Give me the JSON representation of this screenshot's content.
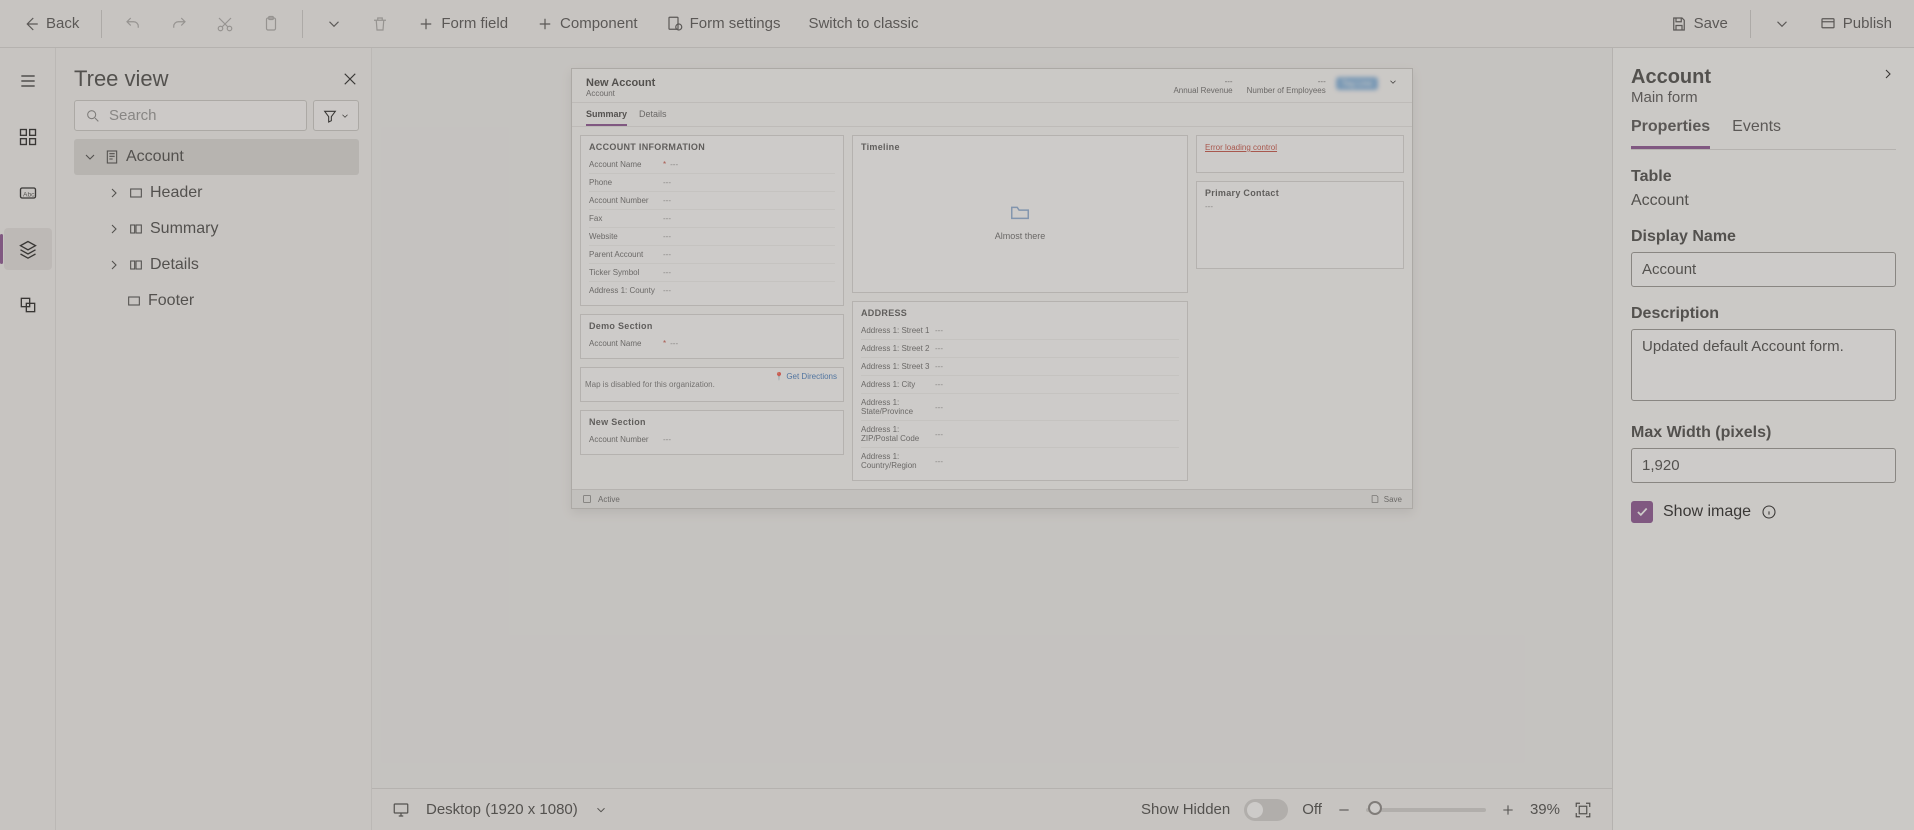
{
  "toolbar": {
    "back": "Back",
    "form_field": "Form field",
    "component": "Component",
    "form_settings": "Form settings",
    "switch_classic": "Switch to classic",
    "save": "Save",
    "publish": "Publish"
  },
  "tree": {
    "title": "Tree view",
    "search_placeholder": "Search",
    "nodes": {
      "account": "Account",
      "header": "Header",
      "summary": "Summary",
      "details": "Details",
      "footer": "Footer"
    }
  },
  "preview": {
    "header_title": "New Account",
    "header_sub": "Account",
    "stat1_label": "Annual Revenue",
    "stat1_val": "---",
    "stat2_label": "Number of Employees",
    "stat2_val": "---",
    "tag": "Tag Line",
    "tabs": {
      "summary": "Summary",
      "details": "Details"
    },
    "sec_account_info": "ACCOUNT INFORMATION",
    "fields": {
      "account_name": "Account Name",
      "phone": "Phone",
      "account_number": "Account Number",
      "fax": "Fax",
      "website": "Website",
      "parent_account": "Parent Account",
      "ticker_symbol": "Ticker Symbol",
      "addr1_county": "Address 1: County"
    },
    "dash": "---",
    "sec_demo": "Demo Section",
    "sec_new": "New Section",
    "map_msg": "Map is disabled for this organization.",
    "get_directions": "Get Directions",
    "timeline_title": "Timeline",
    "timeline_msg": "Almost there",
    "sec_address": "ADDRESS",
    "addr_fields": {
      "s1": "Address 1: Street 1",
      "s2": "Address 1: Street 2",
      "s3": "Address 1: Street 3",
      "city": "Address 1: City",
      "state": "Address 1: State/Province",
      "zip": "Address 1: ZIP/Postal Code",
      "country": "Address 1: Country/Region"
    },
    "err_loading": "Error loading control",
    "primary_contact": "Primary Contact",
    "footer_active": "Active",
    "footer_save": "Save"
  },
  "statusbar": {
    "device": "Desktop (1920 x 1080)",
    "show_hidden": "Show Hidden",
    "off": "Off",
    "zoom": "39%"
  },
  "props": {
    "title": "Account",
    "sub": "Main form",
    "tab_properties": "Properties",
    "tab_events": "Events",
    "table_label": "Table",
    "table_value": "Account",
    "display_name_label": "Display Name",
    "display_name_value": "Account",
    "description_label": "Description",
    "description_value": "Updated default Account form.",
    "max_width_label": "Max Width (pixels)",
    "max_width_value": "1,920",
    "show_image_label": "Show image"
  }
}
